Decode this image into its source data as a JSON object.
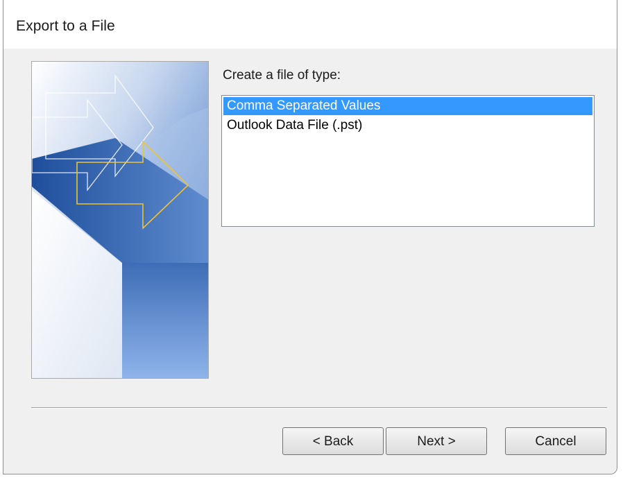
{
  "dialog": {
    "title": "Export to a File"
  },
  "file_type": {
    "label": "Create a file of type:",
    "options": [
      {
        "label": "Comma Separated Values",
        "selected": true
      },
      {
        "label": "Outlook Data File (.pst)",
        "selected": false
      }
    ]
  },
  "buttons": {
    "back_label": "< Back",
    "next_label": "Next >",
    "cancel_label": "Cancel"
  },
  "colors": {
    "selection": "#3399ff",
    "accent_arrow": "#f2c230",
    "banner_blue": "#2e5fa8"
  },
  "icons": {
    "wizard_banner": "export-arrows-illustration"
  }
}
